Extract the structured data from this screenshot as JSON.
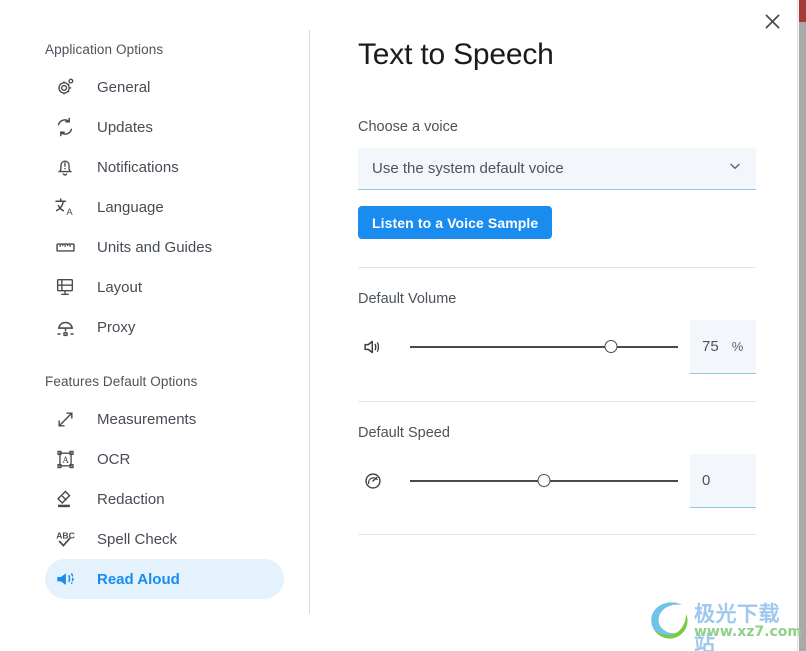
{
  "window": {
    "close_label": "✕",
    "close_icon": "close-icon"
  },
  "sidebar": {
    "groups": [
      {
        "title": "Application Options",
        "items": [
          {
            "label": "General",
            "icon": "gear-icon",
            "active": false
          },
          {
            "label": "Updates",
            "icon": "refresh-icon",
            "active": false
          },
          {
            "label": "Notifications",
            "icon": "bell-alert-icon",
            "active": false
          },
          {
            "label": "Language",
            "icon": "translate-icon",
            "active": false
          },
          {
            "label": "Units and Guides",
            "icon": "ruler-icon",
            "active": false
          },
          {
            "label": "Layout",
            "icon": "layout-icon",
            "active": false
          },
          {
            "label": "Proxy",
            "icon": "proxy-server-icon",
            "active": false
          }
        ]
      },
      {
        "title": "Features Default Options",
        "items": [
          {
            "label": "Measurements",
            "icon": "measure-arrow-icon",
            "active": false
          },
          {
            "label": "OCR",
            "icon": "ocr-box-a-icon",
            "active": false
          },
          {
            "label": "Redaction",
            "icon": "eraser-icon",
            "active": false
          },
          {
            "label": "Spell Check",
            "icon": "abc-check-icon",
            "active": false
          },
          {
            "label": "Read Aloud",
            "icon": "megaphone-icon",
            "active": true
          }
        ]
      }
    ]
  },
  "main": {
    "title": "Text to Speech",
    "voice": {
      "label": "Choose a voice",
      "selected": "Use the system default voice",
      "chevron_icon": "chevron-down-icon",
      "sample_button": "Listen to a Voice Sample"
    },
    "volume": {
      "label": "Default Volume",
      "icon": "speaker-volume-icon",
      "value": "75",
      "unit": "%",
      "percent": 75
    },
    "speed": {
      "label": "Default Speed",
      "icon": "speedometer-icon",
      "value": "0",
      "unit": "",
      "percent": 50
    }
  },
  "watermark": {
    "main": "极光下载站",
    "sub": "www.xz7.com"
  },
  "colors": {
    "accent": "#1a8cf0",
    "active_bg": "#e3f2fd",
    "field_bg": "#f3f7fb",
    "field_underline": "#8ec8e8",
    "text": "#4b535c",
    "scrollbar_top": "#a53a36",
    "scrollbar": "#a9a9a9"
  }
}
